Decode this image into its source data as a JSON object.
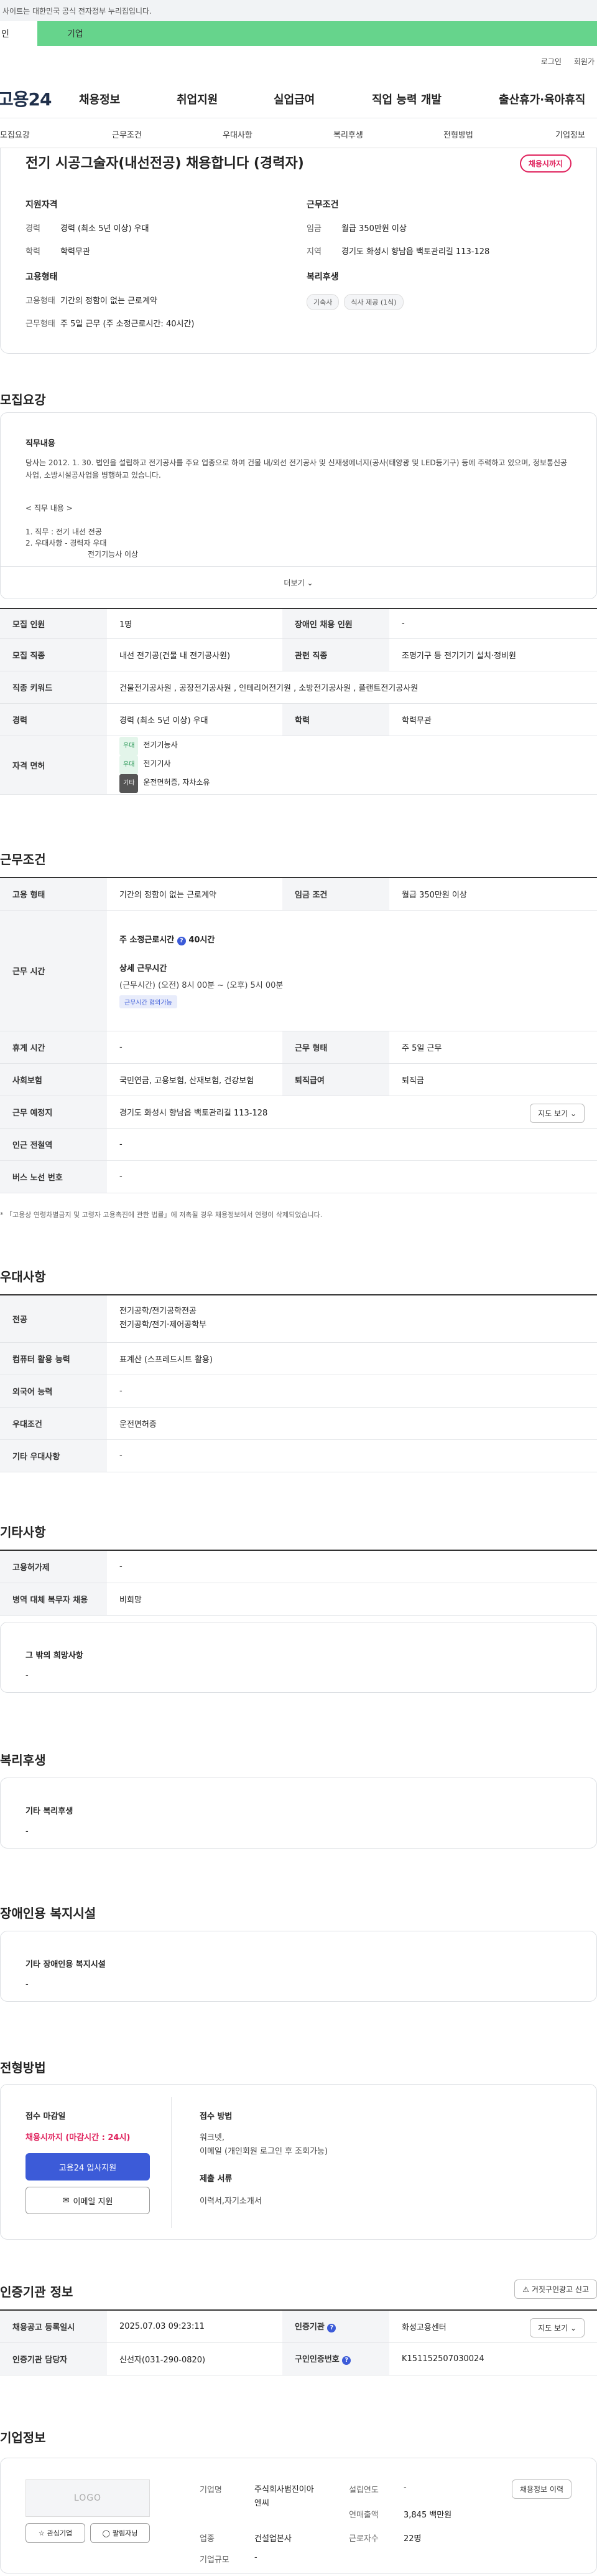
{
  "topbar": {
    "notice": "사이트는 대한민국 공식 전자정부 누리집입니다."
  },
  "site": {
    "s1": "인",
    "s2": "기업"
  },
  "util": {
    "login": "로그인",
    "join": "회원가"
  },
  "logo": "고용24",
  "gnb": [
    "채용정보",
    "취업지원",
    "실업급여",
    "직업 능력 개발",
    "출산휴가·육아휴직"
  ],
  "tabs": [
    "모집요강",
    "근무조건",
    "우대사항",
    "복리후생",
    "전형방법",
    "기업정보"
  ],
  "job": {
    "title": "전기 시공그술자(내선전공) 채용합니다 (경력자)",
    "badge": "채용시까지"
  },
  "summary": {
    "qual_h": "지원자격",
    "career_k": "경력",
    "career_v": "경력 (최소 5년 이상) 우대",
    "edu_k": "학력",
    "edu_v": "학력무관",
    "cond_h": "근무조건",
    "wage_k": "임금",
    "wage_v": "월급 350만원 이상",
    "area_k": "지역",
    "area_v": "경기도 화성시 향남읍 백토관리길 113-128",
    "emp_h": "고용형태",
    "type_k": "고용형태",
    "type_v": "기간의 정함이 없는 근로계약",
    "shift_k": "근무형태",
    "shift_v": "주 5일 근무 (주 소정근로시간: 40시간)",
    "welfare_h": "복리후생",
    "chip1": "기숙사",
    "chip2": "식사 제공 (1식)"
  },
  "recruit": {
    "title": "모집요강",
    "desc_h": "직무내용",
    "desc": "당사는 2012. 1. 30. 법인을 설립하고 전기공사를 주요 업종으로 하여 건물 내/외선 전기공사 및 신재생에너지(공사(태양광 및 LED등기구) 등에 주력하고 있으며, 정보통신공사업, 소방시설공사업을 병행하고 있습니다.",
    "l1": "< 직무 내용 >",
    "l2": "1. 직무 : 전기 내선 전공",
    "l3": "2. 우대사항  - 경력자 우대",
    "l4": "전기기능사 이상",
    "more": "더보기"
  },
  "rtable": {
    "r1h": "모집 인원",
    "r1v": "1명",
    "r1h2": "장애인 채용 인원",
    "r1v2": "-",
    "r2h": "모집 직종",
    "r2v": "내선 전기공(건물 내 전기공사원)",
    "r2h2": "관련 직종",
    "r2v2": "조명기구 등 전기기기 설치·정비원",
    "r3h": "직종 키워드",
    "r3v": "건물전기공사원 , 공장전기공사원 , 인테리어전기원 , 소방전기공사원 , 플랜트전기공사원",
    "r4h": "경력",
    "r4v": "경력 (최소 5년 이상) 우대",
    "r4h2": "학력",
    "r4v2": "학력무관",
    "r5h": "자격 면허",
    "t1": "우대",
    "q1": "전기기능사",
    "t2": "우대",
    "q2": "전기기사",
    "t3": "기타",
    "q3": "운전면허증, 자차소유"
  },
  "work": {
    "title": "근무조건",
    "w1h": "고용 형태",
    "w1v": "기간의 정함이 없는 근로계약",
    "w1h2": "임금 조건",
    "w1v2": "월급 350만원 이상",
    "w2h": "근무 시간",
    "w2a": "주 소정근로시간",
    "w2b": "40시간",
    "w2c": "상세 근무시간",
    "w2d": "(근무시간) (오전) 8시 00분 ~ (오후) 5시 00분",
    "w2e": "근무시간 협의가능",
    "w3h": "휴게 시간",
    "w3v": "-",
    "w3h2": "근무 형태",
    "w3v2": "주 5일 근무",
    "w4h": "사회보험",
    "w4v": "국민연금, 고용보험, 산재보험, 건강보험",
    "w4h2": "퇴직급여",
    "w4v2": "퇴직금",
    "w5h": "근무 예정지",
    "w5v": "경기도 화성시 향남읍 백토관리길 113-128",
    "w5b": "지도 보기",
    "w6h": "인근 전철역",
    "w6v": "-",
    "w7h": "버스 노선 번호",
    "w7v": "-",
    "note": "* 「고용상 연령차별금지 및 고령자 고용촉진에 관한 법률」에 저촉될 경우 채용정보에서 연령이 삭제되었습니다."
  },
  "pref": {
    "title": "우대사항",
    "p1h": "전공",
    "p1v": "전기공학/전기공학전공",
    "p1v2": "전기공학/전기·제어공학부",
    "p2h": "컴퓨터 활용 능력",
    "p2v": "표계산 (스프레드시트 활용)",
    "p3h": "외국어 능력",
    "p3v": "-",
    "p4h": "우대조건",
    "p4v": "운전면허증",
    "p5h": "기타 우대사항",
    "p5v": "-"
  },
  "etc": {
    "title": "기타사항",
    "e1h": "고용허가제",
    "e1v": "-",
    "e2h": "병역 대체 복무자 채용",
    "e2v": "비희망",
    "hope_h": "그 밖의 희망사항",
    "hope_v": "-"
  },
  "welfare": {
    "title": "복리후생",
    "h": "기타 복리후생",
    "v": "-"
  },
  "disab": {
    "title": "장애인용 복지시설",
    "h": "기타 장애인용 복지시설",
    "v": "-"
  },
  "process": {
    "title": "전형방법",
    "deadline_h": "접수 마감일",
    "deadline_v": "채용시까지 (마감시간 : 24시)",
    "apply": "고용24 입사지원",
    "email": "이메일 지원",
    "method_h": "접수 방법",
    "method_v1": "워크넷,",
    "method_v2": "이메일 (개인회원 로그인 후 조회가능)",
    "docs_h": "제출 서류",
    "docs_v": "이력서,자기소개서"
  },
  "cert": {
    "title": "인증기관 정보",
    "report": "거짓구인광고 신고",
    "c1h": "채용공고 등록일시",
    "c1v": "2025.07.03 09:23:11",
    "c1h2": "인증기관",
    "c1v2": "화성고용센터",
    "map": "지도 보기",
    "c2h": "인증기관 담당자",
    "c2v": "신선자(031-290-0820)",
    "c2h2": "구인인증번호",
    "c2v2": "K151152507030024"
  },
  "company": {
    "title": "기업정보",
    "logo": "LOGO",
    "fav": "관심기업",
    "follow": "팔림자닝",
    "n_h": "기업명",
    "n_v1": "주식회사범진이아",
    "n_v2": "엔씨",
    "ind_h": "업종",
    "ind_v": "건설업본사",
    "size_h": "기업규모",
    "size_v": "-",
    "est_h": "설립연도",
    "est_v": "-",
    "sales_h": "연매출액",
    "sales_v": "3,845 백만원",
    "emp_h": "근로자수",
    "emp_v": "22명",
    "jobs": "채용정보 이력"
  }
}
